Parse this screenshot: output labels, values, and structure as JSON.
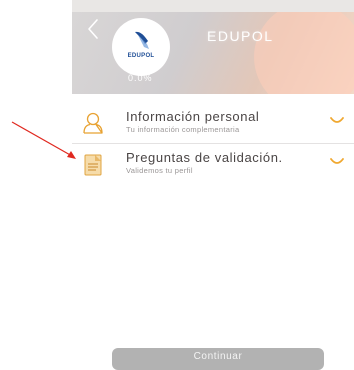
{
  "header": {
    "title": "EDUPOL",
    "logo_text": "EDUPOL",
    "score": "0.0%"
  },
  "sections": [
    {
      "title": "Información personal",
      "subtitle": "Tu información complementaria",
      "icon": "person-outline-icon"
    },
    {
      "title": "Preguntas de validación.",
      "subtitle": "Validemos tu perfil",
      "icon": "document-icon"
    }
  ],
  "actions": {
    "continue_label": "Continuar"
  },
  "colors": {
    "accent": "#f0a830",
    "button_disabled": "#b2b2b2",
    "annotation_arrow": "#e0281f"
  }
}
